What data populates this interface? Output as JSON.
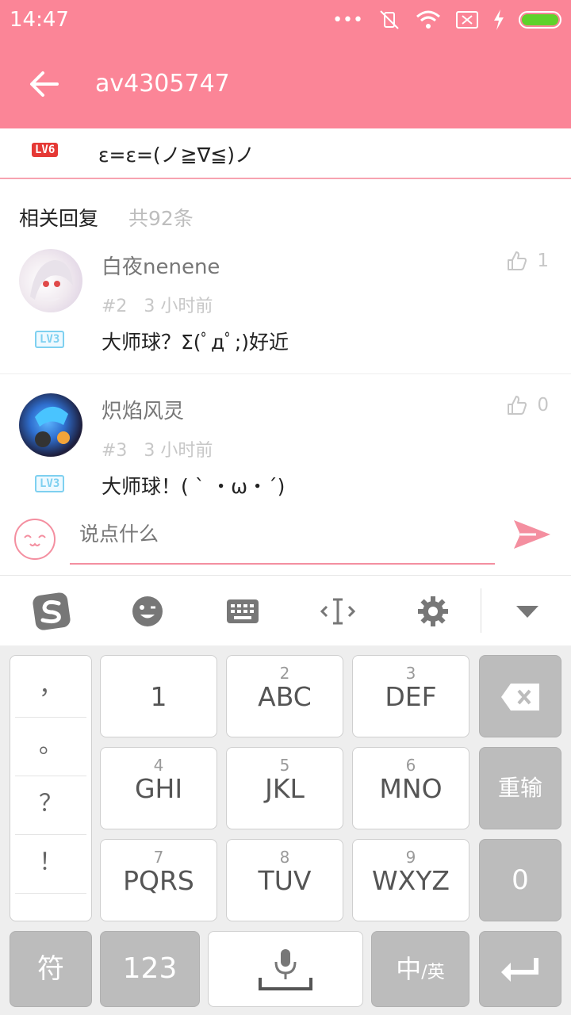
{
  "status_bar": {
    "time": "14:47"
  },
  "toolbar": {
    "title": "av4305747"
  },
  "top_comment": {
    "level": "LV6",
    "text": "ε=ε=(ノ≧∇≦)ノ"
  },
  "related": {
    "title": "相关回复",
    "count": "共92条"
  },
  "comments": [
    {
      "username": "白夜nenene",
      "floor": "#2",
      "time": "3 小时前",
      "likes": "1",
      "level": "LV3",
      "content": "大师球？Σ(ﾟдﾟ;)好近"
    },
    {
      "username": "炽焰风灵",
      "floor": "#3",
      "time": "3 小时前",
      "likes": "0",
      "level": "LV3",
      "content": "大师球！( ` ・ω・´)"
    }
  ],
  "input": {
    "placeholder": "说点什么"
  },
  "keyboard": {
    "punctuation": [
      "，",
      "。",
      "？",
      "！"
    ],
    "keys": {
      "k1": {
        "num": "",
        "letters": "1"
      },
      "k2": {
        "num": "2",
        "letters": "ABC"
      },
      "k3": {
        "num": "3",
        "letters": "DEF"
      },
      "k4": {
        "num": "4",
        "letters": "GHI"
      },
      "k5": {
        "num": "5",
        "letters": "JKL"
      },
      "k6": {
        "num": "6",
        "letters": "MNO"
      },
      "k7": {
        "num": "7",
        "letters": "PQRS"
      },
      "k8": {
        "num": "8",
        "letters": "TUV"
      },
      "k9": {
        "num": "9",
        "letters": "WXYZ"
      }
    },
    "reenter": "重输",
    "zero": "0",
    "symbol": "符",
    "num123": "123",
    "lang_main": "中",
    "lang_sub": "/英"
  }
}
